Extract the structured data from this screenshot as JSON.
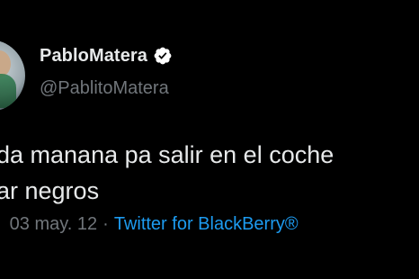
{
  "tweet": {
    "display_name": "PabloMatera",
    "handle": "@PablitoMatera",
    "text_line_1": "da manana pa salir en el coche",
    "text_line_2": "ar negros",
    "date": "03 may. 12",
    "separator": "·",
    "source": "Twitter for BlackBerry®",
    "lead_dot": "·"
  },
  "icons": {
    "verified": "verified-badge-icon",
    "avatar": "user-avatar"
  },
  "colors": {
    "background": "#000000",
    "primary_text": "#e7e9ea",
    "secondary_text": "#71767b",
    "link": "#1d9bf0"
  }
}
